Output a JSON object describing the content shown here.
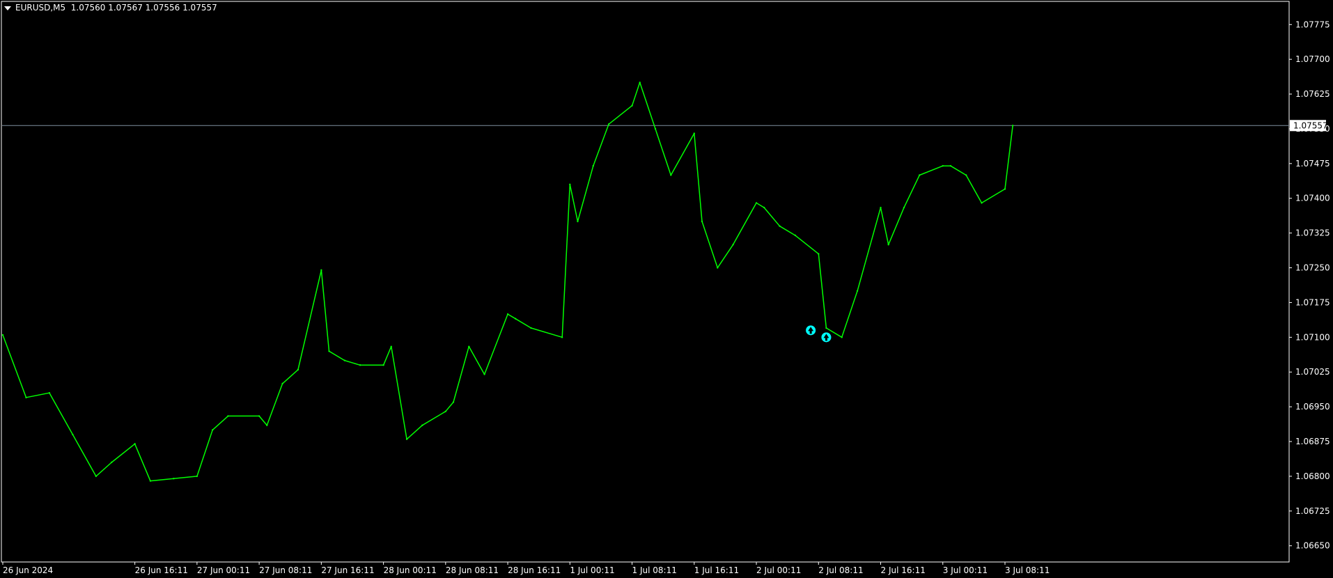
{
  "header": {
    "symbol": "EURUSD,M5",
    "ohlc": "1.07560 1.07567 1.07556 1.07557"
  },
  "colors": {
    "background": "#000000",
    "frame": "#ffffff",
    "price_line": "#7f8f9f",
    "series": "#00ff00",
    "arrows": "#00ffff"
  },
  "chart_data": {
    "type": "line",
    "xlabel": "",
    "ylabel": "",
    "ylim": [
      1.06615,
      1.07825
    ],
    "grid": false,
    "legend": "none",
    "y_ticks": [
      "1.07775",
      "1.07700",
      "1.07625",
      "1.07550",
      "1.07475",
      "1.07400",
      "1.07325",
      "1.07250",
      "1.07175",
      "1.07100",
      "1.07025",
      "1.06950",
      "1.06875",
      "1.06800",
      "1.06725",
      "1.06650"
    ],
    "x_ticks": [
      "26 Jun 2024",
      "26 Jun 16:11",
      "27 Jun 00:11",
      "27 Jun 08:11",
      "27 Jun 16:11",
      "28 Jun 00:11",
      "28 Jun 08:11",
      "28 Jun 16:11",
      "1 Jul 00:11",
      "1 Jul 08:11",
      "1 Jul 16:11",
      "2 Jul 00:11",
      "2 Jul 08:11",
      "2 Jul 16:11",
      "3 Jul 00:11",
      "3 Jul 08:11"
    ],
    "current_price": 1.07557,
    "current_price_label": "1.07557",
    "x": [
      "26 Jun 2024",
      "26 Jun 03:00",
      "26 Jun 06:00",
      "26 Jun 09:00",
      "26 Jun 12:00",
      "26 Jun 14:00",
      "26 Jun 16:11",
      "26 Jun 19:00",
      "26 Jun 22:00",
      "27 Jun 00:11",
      "27 Jun 03:00",
      "27 Jun 05:00",
      "27 Jun 08:11",
      "27 Jun 10:00",
      "27 Jun 12:00",
      "27 Jun 14:00",
      "27 Jun 16:11",
      "27 Jun 18:00",
      "27 Jun 20:00",
      "27 Jun 22:00",
      "28 Jun 00:11",
      "28 Jun 02:00",
      "28 Jun 04:00",
      "28 Jun 06:00",
      "28 Jun 08:11",
      "28 Jun 10:00",
      "28 Jun 12:00",
      "28 Jun 14:00",
      "28 Jun 16:11",
      "28 Jun 18:00",
      "28 Jun 20:00",
      "28 Jun 23:50",
      "1 Jul 00:11",
      "1 Jul 02:00",
      "1 Jul 04:00",
      "1 Jul 06:00",
      "1 Jul 08:11",
      "1 Jul 10:00",
      "1 Jul 12:00",
      "1 Jul 14:00",
      "1 Jul 16:11",
      "1 Jul 18:00",
      "1 Jul 20:00",
      "1 Jul 22:00",
      "2 Jul 00:11",
      "2 Jul 02:00",
      "2 Jul 04:00",
      "2 Jul 06:00",
      "2 Jul 08:11",
      "2 Jul 10:00",
      "2 Jul 12:00",
      "2 Jul 14:00",
      "2 Jul 16:11",
      "2 Jul 18:00",
      "2 Jul 20:00",
      "2 Jul 22:00",
      "3 Jul 00:11",
      "3 Jul 02:00",
      "3 Jul 04:00",
      "3 Jul 06:00",
      "3 Jul 08:11",
      "3 Jul 10:00"
    ],
    "series": [
      {
        "values": [
          1.07105,
          1.0697,
          1.0698,
          1.0689,
          1.068,
          1.0683,
          1.0687,
          1.0679,
          1.06795,
          1.068,
          1.069,
          1.0693,
          1.0693,
          1.0691,
          1.07,
          1.0703,
          1.07245,
          1.0707,
          1.0705,
          1.0704,
          1.0704,
          1.0708,
          1.0688,
          1.0691,
          1.0694,
          1.0696,
          1.0708,
          1.0702,
          1.0715,
          1.0714,
          1.0712,
          1.071,
          1.0743,
          1.0735,
          1.0747,
          1.0756,
          1.076,
          1.0765,
          1.0755,
          1.0745,
          1.0754,
          1.0735,
          1.0725,
          1.073,
          1.0739,
          1.0738,
          1.0734,
          1.0732,
          1.0728,
          1.0712,
          1.071,
          1.072,
          1.0738,
          1.073,
          1.0738,
          1.0745,
          1.0747,
          1.0747,
          1.0745,
          1.0739,
          1.0742,
          1.07557
        ]
      }
    ],
    "annotations": [
      {
        "type": "arrow-up",
        "x": "2 Jul 07:30",
        "y": 1.07115
      },
      {
        "type": "arrow-up",
        "x": "2 Jul 09:30",
        "y": 1.071
      }
    ]
  }
}
